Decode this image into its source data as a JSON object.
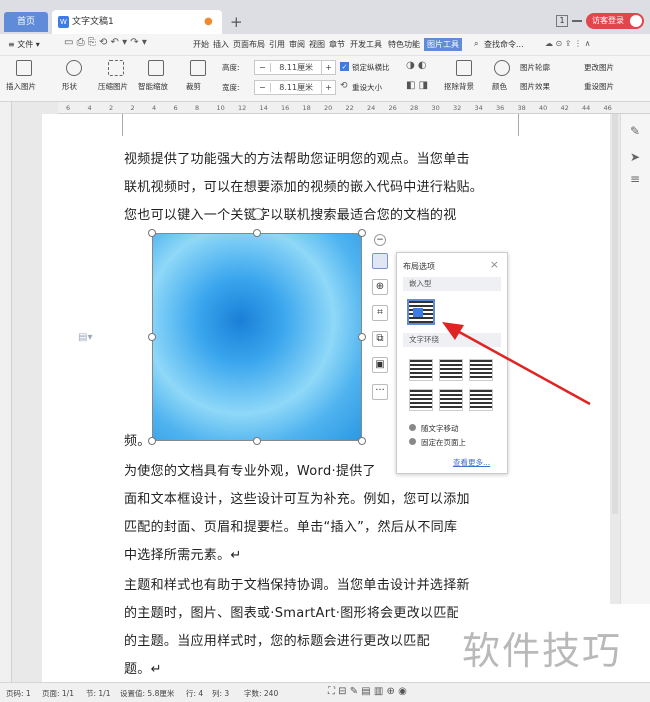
{
  "tabs": {
    "home": "首页",
    "doc_title": "文字文稿1",
    "new_tab": "+",
    "page_badge": "1",
    "visitor": "访客登录"
  },
  "menu": {
    "file": "≡ 文件 ▾",
    "items": [
      "开始",
      "插入",
      "页面布局",
      "引用",
      "审阅",
      "视图",
      "章节",
      "开发工具",
      "特色功能"
    ],
    "active": "图片工具",
    "search": "查找命令..."
  },
  "ribbon": {
    "insert_picture": "插入图片",
    "shape": "形状",
    "compress": "压缩图片",
    "smart_scale": "智能缩放",
    "crop": "裁剪",
    "height_label": "高度:",
    "height_value": "8.11厘米",
    "width_label": "宽度:",
    "width_value": "8.11厘米",
    "lock_ratio": "锁定纵横比",
    "reset_size": "重设大小",
    "remove_bg": "抠除背景",
    "color": "颜色",
    "picture_outline": "图片轮廓",
    "picture_effects": "图片效果",
    "change_picture": "更改图片",
    "reset_picture": "重设图片"
  },
  "ruler": [
    "6",
    "4",
    "2",
    "2",
    "4",
    "6",
    "8",
    "10",
    "12",
    "14",
    "16",
    "18",
    "20",
    "22",
    "24",
    "26",
    "28",
    "30",
    "32",
    "34",
    "36",
    "38",
    "40",
    "42",
    "44",
    "46"
  ],
  "document": {
    "lines_top": [
      "视频提供了功能强大的方法帮助您证明您的观点。当您单击",
      "联机视频时，可以在想要添加的视频的嵌入代码中进行粘贴。",
      "您也可以键入一个关键字以联机搜索最适合您的文档的视"
    ],
    "line_after_image": "频。",
    "lines_bottom": [
      "为使您的文档具有专业外观，Word·提供了",
      "面和文本框设计，这些设计可互为补充。例如，您可以添加",
      "匹配的封面、页眉和提要栏。单击“插入”，然后从不同库",
      "中选择所需元素。↵",
      "主题和样式也有助于文档保持协调。当您单击设计并选择新",
      "的主题时，图片、图表或·SmartArt·图形将会更改以匹配新",
      "的主题。当应用样式时，您的标题会进行更改以匹配",
      "题。↵"
    ]
  },
  "layout_panel": {
    "title": "布局选项",
    "close": "×",
    "inline_label": "嵌入型",
    "wrap_label": "文字环绕",
    "opt_move": "随文字移动",
    "opt_fixed": "固定在页面上",
    "more": "查看更多..."
  },
  "status": {
    "page_num": "页码: 1",
    "pages": "页面: 1/1",
    "section": "节: 1/1",
    "setting": "设置值: 5.8厘米",
    "row": "行: 4",
    "col": "列: 3",
    "words": "字数: 240"
  },
  "watermark": "软件技巧",
  "colors": {
    "accent": "#5f8bd8",
    "visitor": "#e3454d",
    "arrow": "#e02424"
  }
}
